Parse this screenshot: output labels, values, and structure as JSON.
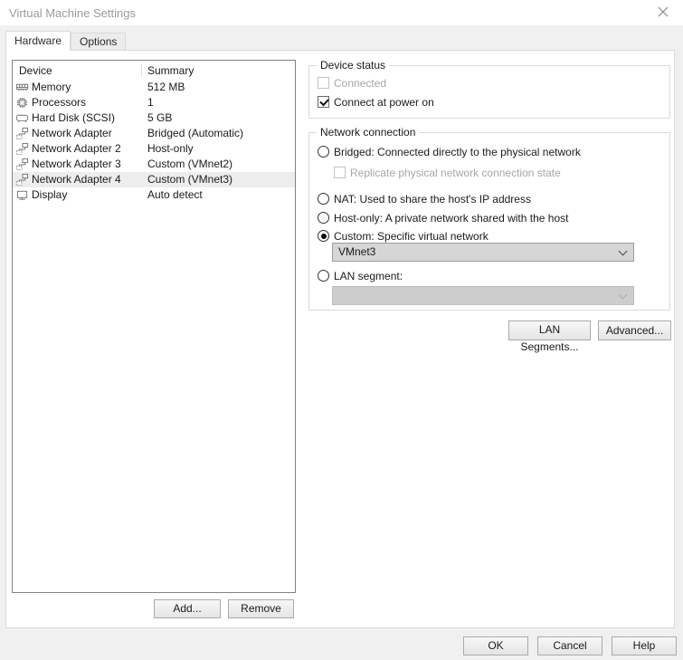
{
  "window": {
    "title": "Virtual Machine Settings"
  },
  "tabs": [
    {
      "label": "Hardware",
      "active": true
    },
    {
      "label": "Options",
      "active": false
    }
  ],
  "icons": {
    "close": "close-x",
    "memory": "ram-module",
    "processors": "cpu-chip",
    "hard_disk": "disk-drive",
    "network": "network-nodes",
    "display": "monitor",
    "dropdown": "chevron-down"
  },
  "colors": {
    "window_bg": "#f0f0f0",
    "panel_bg": "#ffffff",
    "selected_row_bg": "#ededed",
    "combo_bg": "#d6d6d6",
    "disabled_text": "#a6a6a6"
  },
  "device_list": {
    "columns": [
      "Device",
      "Summary"
    ],
    "rows": [
      {
        "icon": "memory",
        "device": "Memory",
        "summary": "512 MB",
        "selected": false
      },
      {
        "icon": "processors",
        "device": "Processors",
        "summary": "1",
        "selected": false
      },
      {
        "icon": "hard_disk",
        "device": "Hard Disk (SCSI)",
        "summary": "5 GB",
        "selected": false
      },
      {
        "icon": "network",
        "device": "Network Adapter",
        "summary": "Bridged (Automatic)",
        "selected": false
      },
      {
        "icon": "network",
        "device": "Network Adapter 2",
        "summary": "Host-only",
        "selected": false
      },
      {
        "icon": "network",
        "device": "Network Adapter 3",
        "summary": "Custom (VMnet2)",
        "selected": false
      },
      {
        "icon": "network",
        "device": "Network Adapter 4",
        "summary": "Custom (VMnet3)",
        "selected": true
      },
      {
        "icon": "display",
        "device": "Display",
        "summary": "Auto detect",
        "selected": false
      }
    ]
  },
  "device_status": {
    "title": "Device status",
    "checkboxes": [
      {
        "label": "Connected",
        "checked": false,
        "enabled": false
      },
      {
        "label": "Connect at power on",
        "checked": true,
        "enabled": true
      }
    ]
  },
  "network_connection": {
    "title": "Network connection",
    "bridged": {
      "label": "Bridged: Connected directly to the physical network",
      "selected": false
    },
    "replicate": {
      "label": "Replicate physical network connection state",
      "checked": false,
      "enabled": false
    },
    "nat": {
      "label": "NAT: Used to share the host's IP address",
      "selected": false
    },
    "host_only": {
      "label": "Host-only: A private network shared with the host",
      "selected": false
    },
    "custom": {
      "label": "Custom: Specific virtual network",
      "selected": true
    },
    "custom_network_combo": {
      "value": "VMnet3",
      "enabled": true
    },
    "lan_segment": {
      "label": "LAN segment:",
      "selected": false
    },
    "lan_segment_combo": {
      "value": "",
      "enabled": false
    }
  },
  "actions": {
    "add": "Add...",
    "remove": "Remove",
    "lan_segments": "LAN Segments...",
    "advanced": "Advanced...",
    "ok": "OK",
    "cancel": "Cancel",
    "help": "Help"
  }
}
